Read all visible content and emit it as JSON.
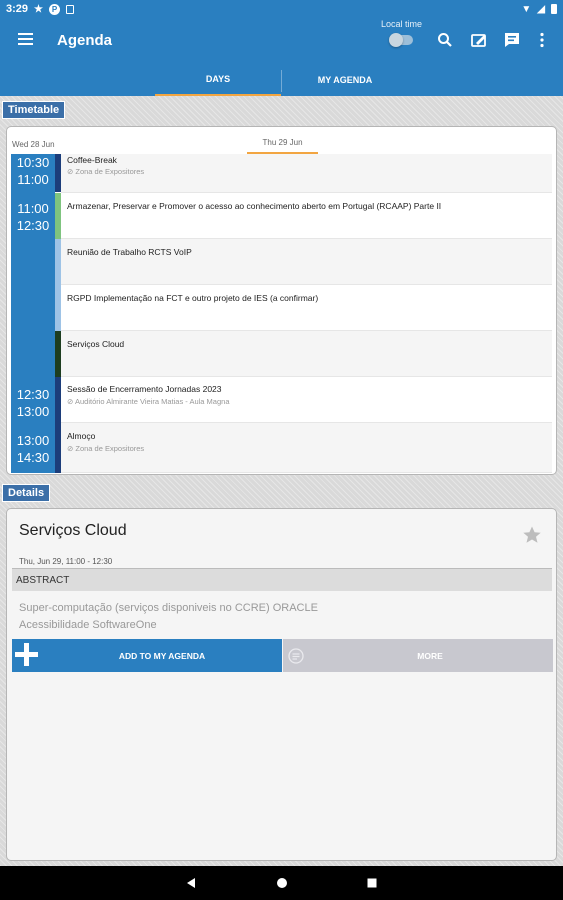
{
  "status_bar": {
    "time": "3:29"
  },
  "app_bar": {
    "title": "Agenda",
    "local_time_label": "Local time",
    "local_time_enabled": false
  },
  "tabs": [
    {
      "label": "DAYS",
      "active": true
    },
    {
      "label": "MY AGENDA",
      "active": false
    }
  ],
  "timetable": {
    "section_label": "Timetable",
    "days": [
      "Wed 28 Jun",
      "Thu 29 Jun"
    ],
    "active_day": "Thu 29 Jun",
    "time_labels": [
      {
        "start": "10:30",
        "end": "11:00"
      },
      {
        "start": "11:00",
        "end": "12:30"
      },
      {
        "start": "12:30",
        "end": "13:00"
      },
      {
        "start": "13:00",
        "end": "14:30"
      }
    ],
    "sessions": [
      {
        "title": "Coffee-Break",
        "location": "Zona de Expositores",
        "color": "#1c3d7a"
      },
      {
        "title": "Armazenar, Preservar e Promover o acesso ao conhecimento aberto em Portugal (RCAAP) Parte II",
        "location": "",
        "color": "#7fc47f"
      },
      {
        "title": "Reunião de Trabalho RCTS VoIP",
        "location": "",
        "color": "#9ec3e6"
      },
      {
        "title": "RGPD Implementação na FCT e outro projeto de IES (a confirmar)",
        "location": "",
        "color": "#9ec3e6"
      },
      {
        "title": "Serviços Cloud",
        "location": "",
        "color": "#1d3d1f"
      },
      {
        "title": "Sessão de Encerramento Jornadas 2023",
        "location": "Auditório Almirante Vieira Matias - Aula Magna",
        "color": "#1c3d7a"
      },
      {
        "title": "Almoço",
        "location": "Zona de Expositores",
        "color": "#1c3d7a"
      }
    ]
  },
  "details": {
    "section_label": "Details",
    "title": "Serviços Cloud",
    "time": "Thu, Jun 29, 11:00 - 12:30",
    "abstract_label": "ABSTRACT",
    "description_lines": [
      "Super-computação (serviços disponiveis no CCRE) ORACLE",
      "Acessibilidade SoftwareOne"
    ],
    "add_button_label": "ADD TO MY AGENDA",
    "more_button_label": "MORE",
    "favorited": false
  },
  "colors": {
    "primary": "#2a7fc0",
    "accent": "#f2a541",
    "section_label_bg": "#3b6fa8"
  }
}
